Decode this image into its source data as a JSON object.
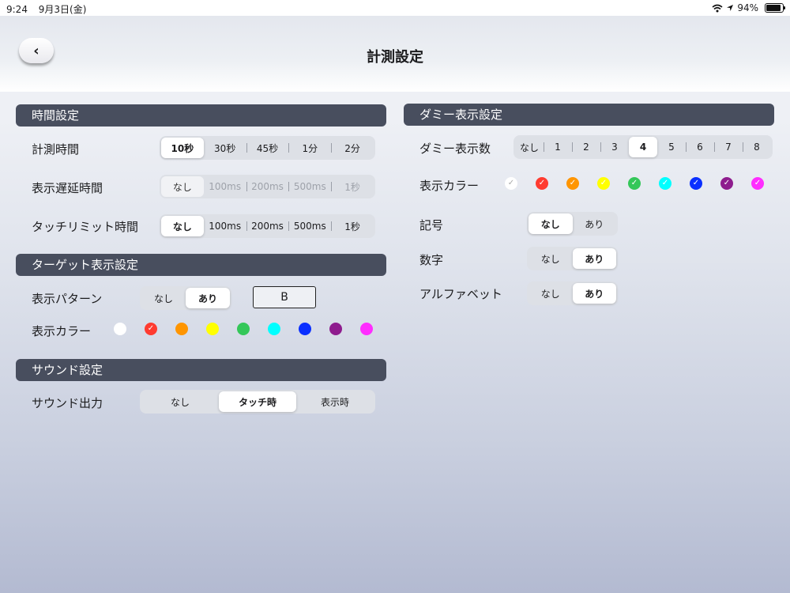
{
  "status": {
    "time": "9:24",
    "date": "9月3日(金)",
    "battery": "94%"
  },
  "header": {
    "title": "計測設定",
    "back_icon": "‹"
  },
  "time_settings": {
    "title": "時間設定",
    "measure_time": {
      "label": "計測時間",
      "options": [
        "10秒",
        "30秒",
        "45秒",
        "1分",
        "2分"
      ],
      "selected": 0
    },
    "display_delay": {
      "label": "表示遅延時間",
      "options": [
        "なし",
        "100ms",
        "200ms",
        "500ms",
        "1秒"
      ],
      "selected": 0
    },
    "touch_limit": {
      "label": "タッチリミット時間",
      "options": [
        "なし",
        "100ms",
        "200ms",
        "500ms",
        "1秒"
      ],
      "selected": 0
    }
  },
  "target_settings": {
    "title": "ターゲット表示設定",
    "pattern": {
      "label": "表示パターン",
      "options": [
        "なし",
        "あり"
      ],
      "selected": 1,
      "value_box": "B"
    },
    "color": {
      "label": "表示カラー",
      "colors": [
        "#ffffff",
        "#ff3b30",
        "#ff9500",
        "#ffff00",
        "#34c759",
        "#00ffff",
        "#0a2fff",
        "#8e1c8e",
        "#ff2dff"
      ],
      "selected": 1
    }
  },
  "sound_settings": {
    "title": "サウンド設定",
    "output": {
      "label": "サウンド出力",
      "options": [
        "なし",
        "タッチ時",
        "表示時"
      ],
      "selected": 1
    }
  },
  "dummy_settings": {
    "title": "ダミー表示設定",
    "count": {
      "label": "ダミー表示数",
      "options": [
        "なし",
        "1",
        "2",
        "3",
        "4",
        "5",
        "6",
        "7",
        "8"
      ],
      "selected": 4
    },
    "color": {
      "label": "表示カラー",
      "colors": [
        "#ffffff",
        "#ff3b30",
        "#ff9500",
        "#ffff00",
        "#34c759",
        "#00ffff",
        "#0a2fff",
        "#8e1c8e",
        "#ff2dff"
      ],
      "checked_all": true
    },
    "symbol": {
      "label": "記号",
      "options": [
        "なし",
        "あり"
      ],
      "selected": 0
    },
    "number": {
      "label": "数字",
      "options": [
        "なし",
        "あり"
      ],
      "selected": 1
    },
    "alphabet": {
      "label": "アルファベット",
      "options": [
        "なし",
        "あり"
      ],
      "selected": 1
    }
  }
}
